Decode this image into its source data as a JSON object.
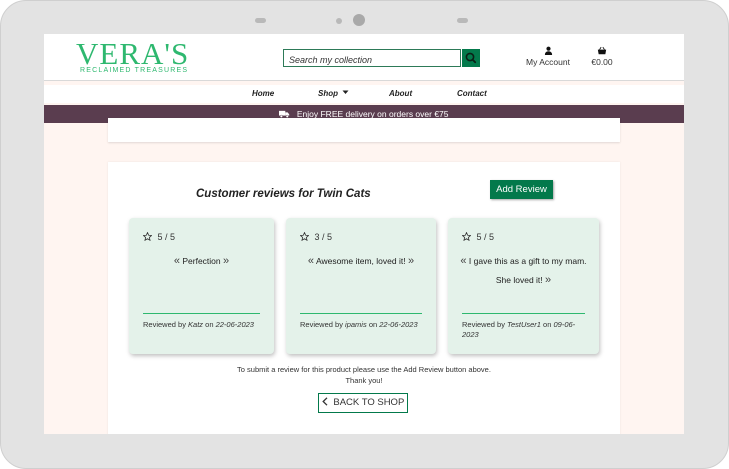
{
  "header": {
    "logo_main": "VERA'S",
    "logo_sub": "RECLAIMED TREASURES",
    "search_placeholder": "Search my collection",
    "account_label": "My Account",
    "cart_total": "€0.00"
  },
  "nav": {
    "items": [
      "Home",
      "Shop",
      "About",
      "Contact"
    ]
  },
  "banner": {
    "text": "Enjoy FREE delivery on orders over €75"
  },
  "reviews_section": {
    "title": "Customer reviews for Twin Cats",
    "add_review_label": "Add Review",
    "reviews": [
      {
        "rating": "5 / 5",
        "text": "Perfection",
        "reviewed_by_label": "Reviewed by",
        "user": "Katz",
        "on_label": "on",
        "date": "22-06-2023"
      },
      {
        "rating": "3 / 5",
        "text": "Awesome item, loved it!",
        "reviewed_by_label": "Reviewed by",
        "user": "ipamis",
        "on_label": "on",
        "date": "22-06-2023"
      },
      {
        "rating": "5 / 5",
        "text": "I gave this as a gift to my mam. She loved it!",
        "reviewed_by_label": "Reviewed by",
        "user": "TestUser1",
        "on_label": "on",
        "date": "09-06-2023"
      }
    ],
    "submit_note_line1": "To submit a review for this product please use the Add Review button above.",
    "submit_note_line2": "Thank you!",
    "back_label": "BACK TO SHOP"
  },
  "colors": {
    "brand_green": "#2eb86f",
    "button_green": "#03794b",
    "banner_bg": "#5a3d4f",
    "page_bg": "#fff5f1",
    "review_card_bg": "#e4f2ea"
  }
}
